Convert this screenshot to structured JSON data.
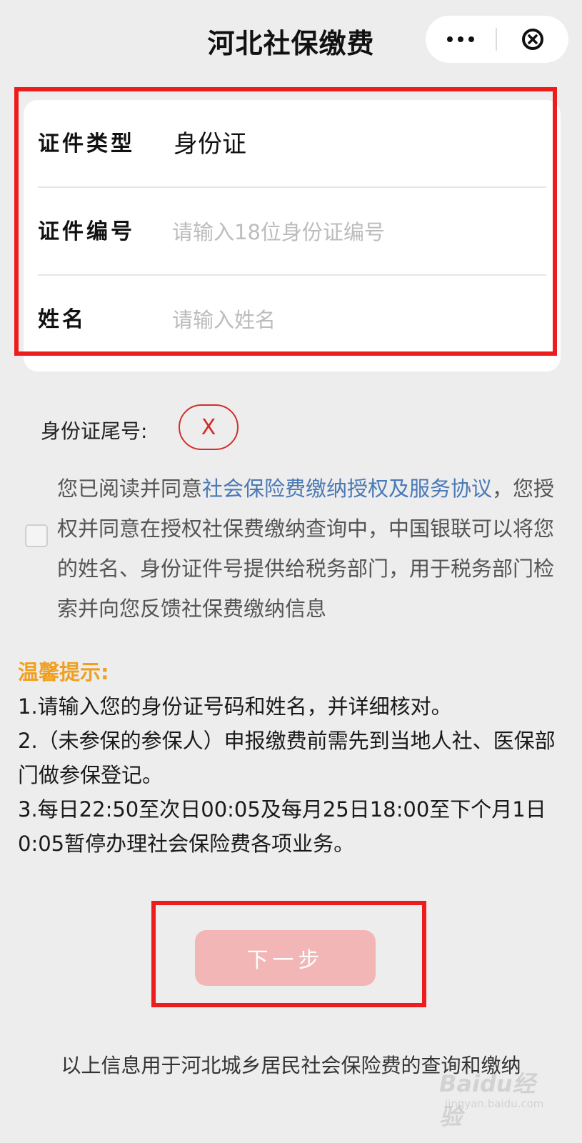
{
  "header": {
    "title": "河北社保缴费",
    "more_icon": "more-dots-icon",
    "close_icon": "close-circle-icon"
  },
  "form": {
    "cert_type": {
      "label": "证件类型",
      "value": "身份证"
    },
    "cert_number": {
      "label": "证件编号",
      "placeholder": "请输入18位身份证编号",
      "value": ""
    },
    "name": {
      "label": "姓名",
      "placeholder": "请输入姓名",
      "value": ""
    }
  },
  "id_tail": {
    "label": "身份证尾号:",
    "value": "X"
  },
  "agreement": {
    "checked": false,
    "prefix": "您已阅读并同意",
    "link_text": "社会保险费缴纳授权及服务协议",
    "suffix": "，您授权并同意在授权社保费缴纳查询中，中国银联可以将您的姓名、身份证件号提供给税务部门，用于税务部门检索并向您反馈社保费缴纳信息"
  },
  "tips": {
    "title": "温馨提示:",
    "items": [
      "1.请输入您的身份证号码和姓名，并详细核对。",
      "2.（未参保的参保人）申报缴费前需先到当地人社、医保部门做参保登记。",
      "3.每日22:50至次日00:05及每月25日18:00至下个月1日0:05暂停办理社会保险费各项业务。"
    ]
  },
  "next_button": {
    "label": "下一步"
  },
  "footer": {
    "note": "以上信息用于河北城乡居民社会保险费的查询和缴纳"
  },
  "watermark": {
    "main": "Baidu经验",
    "sub": "jingyan.baidu.com"
  },
  "colors": {
    "background": "#ededed",
    "highlight_frame": "#ee1d1d",
    "link": "#4a79b6",
    "tip_title": "#f0a020",
    "button_disabled": "#f3b6b6",
    "badge": "#d42c2c"
  }
}
